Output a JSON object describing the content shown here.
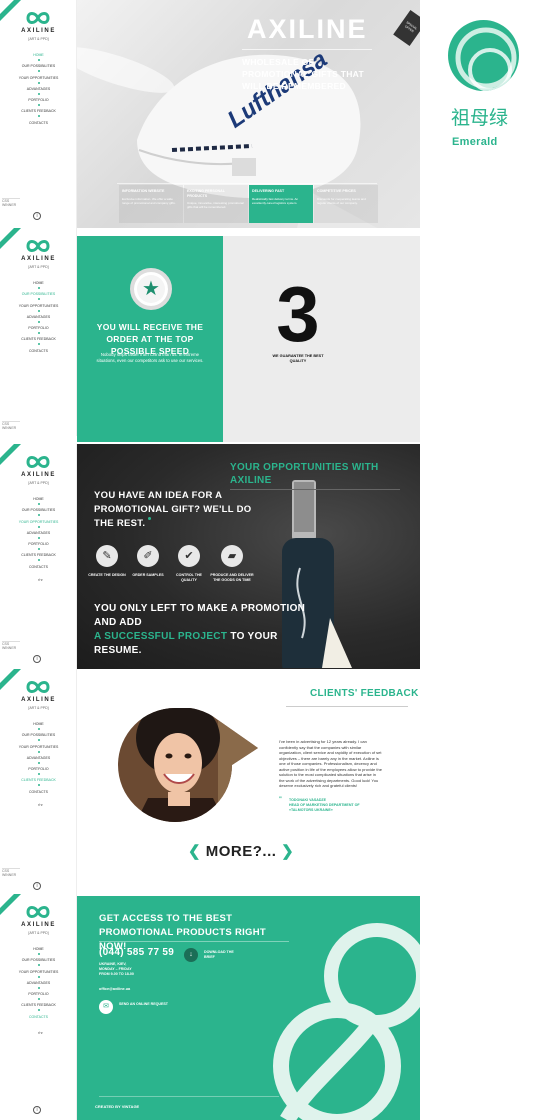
{
  "brand": {
    "name": "AXILINE",
    "subtitle": "[ART & PPD]",
    "swatch_name_cn": "祖母绿",
    "swatch_name_en": "Emerald",
    "accent_color": "#2bb48d"
  },
  "nav": {
    "items": [
      "HOME",
      "OUR POSSIBILITIES",
      "YOUR OPPORTUNITIES",
      "ADVANTAGES",
      "PORTFOLIO",
      "CLIENTS FEEDBACK",
      "CONTACTS"
    ],
    "partner_label": "rhr",
    "badge_label": "CSS WINNER"
  },
  "hero": {
    "title": "AXILINE",
    "subtitle": "WHOLESALE OF PROMOTIONAL GIFTS THAT WILL BE REMEMBERED",
    "stamp": "SPECIAL OFFER",
    "features": [
      {
        "title": "INFORMATION WEBSITE",
        "desc": "Exclusive information. We offer a wide range of promotional and company gifts."
      },
      {
        "title": "EXCITING PERSONAL PRODUCTS",
        "desc": "Unique, innovative, interesting promotional gifts that will be remembered."
      },
      {
        "title": "DELIVERING FAST",
        "desc": "Realistically fast delivery terms. An excellently-tuned logistics system."
      },
      {
        "title": "COMPETITIVE PRICES",
        "desc": "Discounts for cooperating teams and regular clients of our company."
      }
    ]
  },
  "speed": {
    "headline": "YOU WILL RECEIVE THE ORDER AT THE TOP POSSIBLE SPEED",
    "text": "Nobody ships faster from China than us. In extreme situations, even our competitors ask to use our services.",
    "number": "3",
    "number_caption": "WE GUARANTEE THE BEST QUALITY"
  },
  "opportunities": {
    "title": "YOUR OPPORTUNITIES WITH AXILINE",
    "idea": "YOU HAVE AN IDEA FOR A PROMOTIONAL GIFT? WE'LL DO THE REST.",
    "steps": [
      {
        "label": "CREATE THE DESIGN",
        "icon": "pencil-icon"
      },
      {
        "label": "ORDER SAMPLES",
        "icon": "edit-icon"
      },
      {
        "label": "CONTROL THE QUALITY",
        "icon": "thumbs-up-icon"
      },
      {
        "label": "PRODUCE AND DELIVER THE GOODS ON TIME",
        "icon": "truck-icon"
      }
    ],
    "closing_1": "YOU ONLY LEFT TO MAKE A PROMOTION AND ADD",
    "closing_accent": "A SUCCESSFUL PROJECT",
    "closing_2": "TO YOUR RESUME."
  },
  "feedback": {
    "title": "CLIENTS' FEEDBACK",
    "quote": "I've been in advertising for 12 years already. I can confidently say that the companies with similar organization, client service and rapidity of execution of set objectives – there are barely any in the market. Axiline is one of those companies. Professionalism, decency and active position in life of the employees allow to provide the solution to the most complicated situations that arise in the work of the advertising departments. Good luck! You deserve exclusively rich and grateful clients!",
    "author": "TODONAKI VASADZE",
    "author_role": "HEAD OF MARKETING DEPARTMENT OF «TALMOTORS UKRAINE»",
    "more_label": "MORE?..."
  },
  "contact": {
    "headline": "GET ACCESS TO THE BEST PROMOTIONAL PRODUCTS RIGHT NOW!",
    "phone": "(044) 585 77 59",
    "address": "UKRAINE, KIEV,",
    "hours_days": "MONDAY – FRIDAY",
    "hours_time": "FROM 9-00 TO 18-00",
    "email": "office@axiline.ua",
    "download_label": "DOWNLOAD THE BRIEF",
    "request_label": "SEND AN ONLINE REQUEST",
    "created_by": "CREATED BY VINTAGE"
  }
}
